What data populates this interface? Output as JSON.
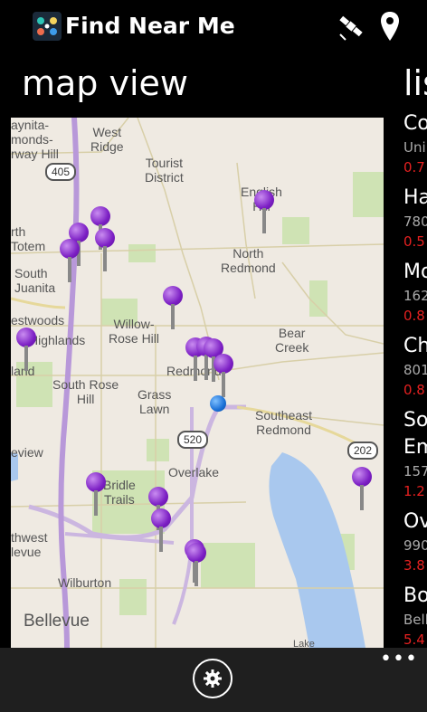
{
  "app": {
    "title": "Find Near Me",
    "icon": "app-logo-icon"
  },
  "header_icons": [
    "satellite-icon",
    "location-pin-icon"
  ],
  "pivot": {
    "map_title": "map view",
    "list_title": "lis"
  },
  "map": {
    "labels": [
      "aynita-\nmonds-\nrway Hill",
      "West\nRidge",
      "Tourist\nDistrict",
      "English\nHill",
      "rth\nTotem",
      "South\nJuanita",
      "North\nRedmond",
      "estwoods",
      "Highlands",
      "Willow-\nRose Hill",
      "Bear\nCreek",
      "land",
      "South Rose\nHill",
      "Redmond",
      "Grass\nLawn",
      "Southeast\nRedmond",
      "eview",
      "Overlake",
      "Bridle\nTrails",
      "thwest\nlevue",
      "Wilburton",
      "Bellevue",
      "Lake"
    ],
    "shields": [
      "405",
      "520",
      "202"
    ],
    "zoom_label": "+"
  },
  "list": {
    "items": [
      {
        "name": "Co",
        "address": "Uni",
        "distance": "0.7"
      },
      {
        "name": "Ha",
        "address": "780",
        "distance": "0.5"
      },
      {
        "name": "Mo",
        "address": "162",
        "distance": "0.8"
      },
      {
        "name": "Ch",
        "address": "801",
        "distance": "0.8"
      },
      {
        "name": "So",
        "name2": "Em",
        "address": "157",
        "distance": "1.2"
      },
      {
        "name": "Ov",
        "address": "990",
        "distance": "3.8"
      },
      {
        "name": "Bo",
        "address": "Bell",
        "distance": "5.4"
      }
    ]
  },
  "appbar": {
    "settings_icon": "gear-icon",
    "more_label": "•••"
  },
  "colors": {
    "pin": "#7c1fc4",
    "distance": "#e52020",
    "zoom": "#1e90ff",
    "background": "#000000"
  }
}
